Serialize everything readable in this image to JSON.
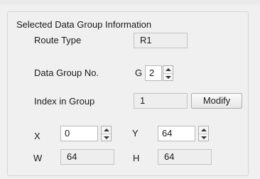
{
  "groupbox": {
    "title": "Selected Data Group Information"
  },
  "route_type": {
    "label": "Route Type",
    "value": "R1"
  },
  "data_group": {
    "label": "Data Group No.",
    "prefix": "G",
    "value": "2"
  },
  "index_in_group": {
    "label": "Index in Group",
    "value": "1",
    "modify_label": "Modify"
  },
  "x": {
    "label": "X",
    "value": "0"
  },
  "y": {
    "label": "Y",
    "value": "64"
  },
  "w": {
    "label": "W",
    "value": "64"
  },
  "h": {
    "label": "H",
    "value": "64"
  }
}
